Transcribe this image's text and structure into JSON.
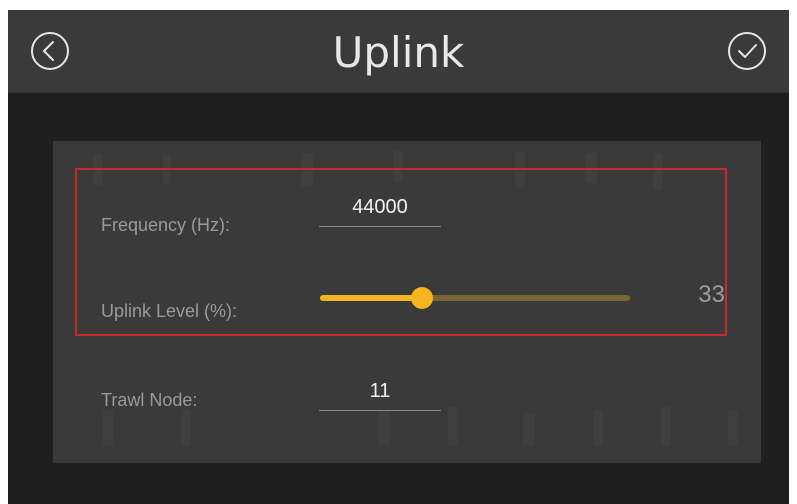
{
  "header": {
    "title": "Uplink",
    "back_icon": "back-arrow-circle-icon",
    "confirm_icon": "checkmark-circle-icon"
  },
  "form": {
    "frequency": {
      "label": "Frequency (Hz):",
      "value": "44000"
    },
    "uplink_level": {
      "label": "Uplink Level (%):",
      "value": "33",
      "fraction": 0.33
    },
    "trawl_node": {
      "label": "Trawl Node:",
      "value": "11"
    }
  },
  "colors": {
    "accent": "#f4b51f",
    "track": "#7a6633",
    "highlight_border": "#c42b2b",
    "header_bg": "#3a3a3a",
    "panel_bg": "#3a3a3a",
    "screen_bg": "#1f1f1f"
  }
}
